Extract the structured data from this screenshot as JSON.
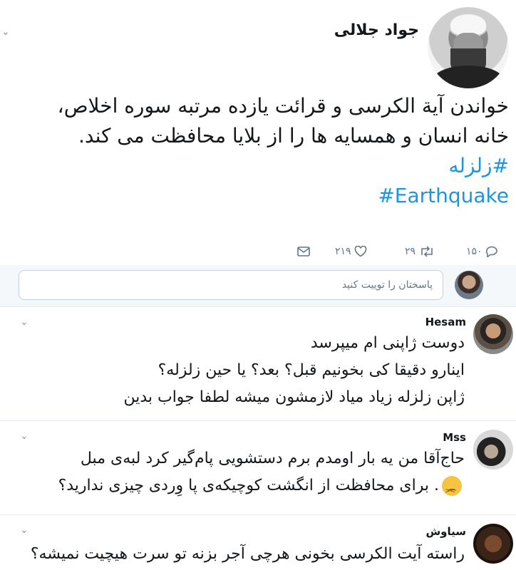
{
  "main_tweet": {
    "author_name": "جواد جلالی",
    "text_line_1": "خواندن آیة الکرسی و قرائت یازده مرتبه سوره اخلاص،",
    "text_line_2": "خانه انسان و همسایه ها را از بلایا محافظت می کند.",
    "hashtags": [
      "#زلزله",
      "#Earthquake"
    ],
    "actions": {
      "replies": "۱۵۰",
      "retweets": "۲۹",
      "likes": "۲۱۹"
    }
  },
  "composer": {
    "placeholder": "پاسختان را توییت کنید"
  },
  "replies": [
    {
      "name": "Hesam",
      "lines": [
        "دوست ژاپنی ام میپرسد",
        "اینارو دقیقا کی بخونیم قبل؟ بعد؟ یا حین زلزله؟",
        "ژاپن زلزله زیاد میاد لازمشون میشه لطفا جواب بدین"
      ]
    },
    {
      "name": "Mss",
      "lines": [
        "حاج‌آقا من یه بار اومدم برم دستشویی پام‌گیر کرد لبه‌ی مبل",
        ". برای محافظت از انگشت کوچیکه‌ی پا وِردی چیزی ندارید؟"
      ],
      "emoji": "tired-face-emoji"
    },
    {
      "name": "سیاوش",
      "lines": [
        "راسته آیت الکرسی بخونی هرچی آجر بزنه تو سرت هیچیت نمیشه؟"
      ]
    }
  ],
  "icons": {
    "reply": "reply-icon",
    "retweet": "retweet-icon",
    "like": "heart-icon",
    "dm": "envelope-icon",
    "more": "chevron-down-icon"
  },
  "colors": {
    "hashtag": "#1b95e0",
    "secondary_text": "#657786",
    "divider": "#e6ecf0"
  }
}
